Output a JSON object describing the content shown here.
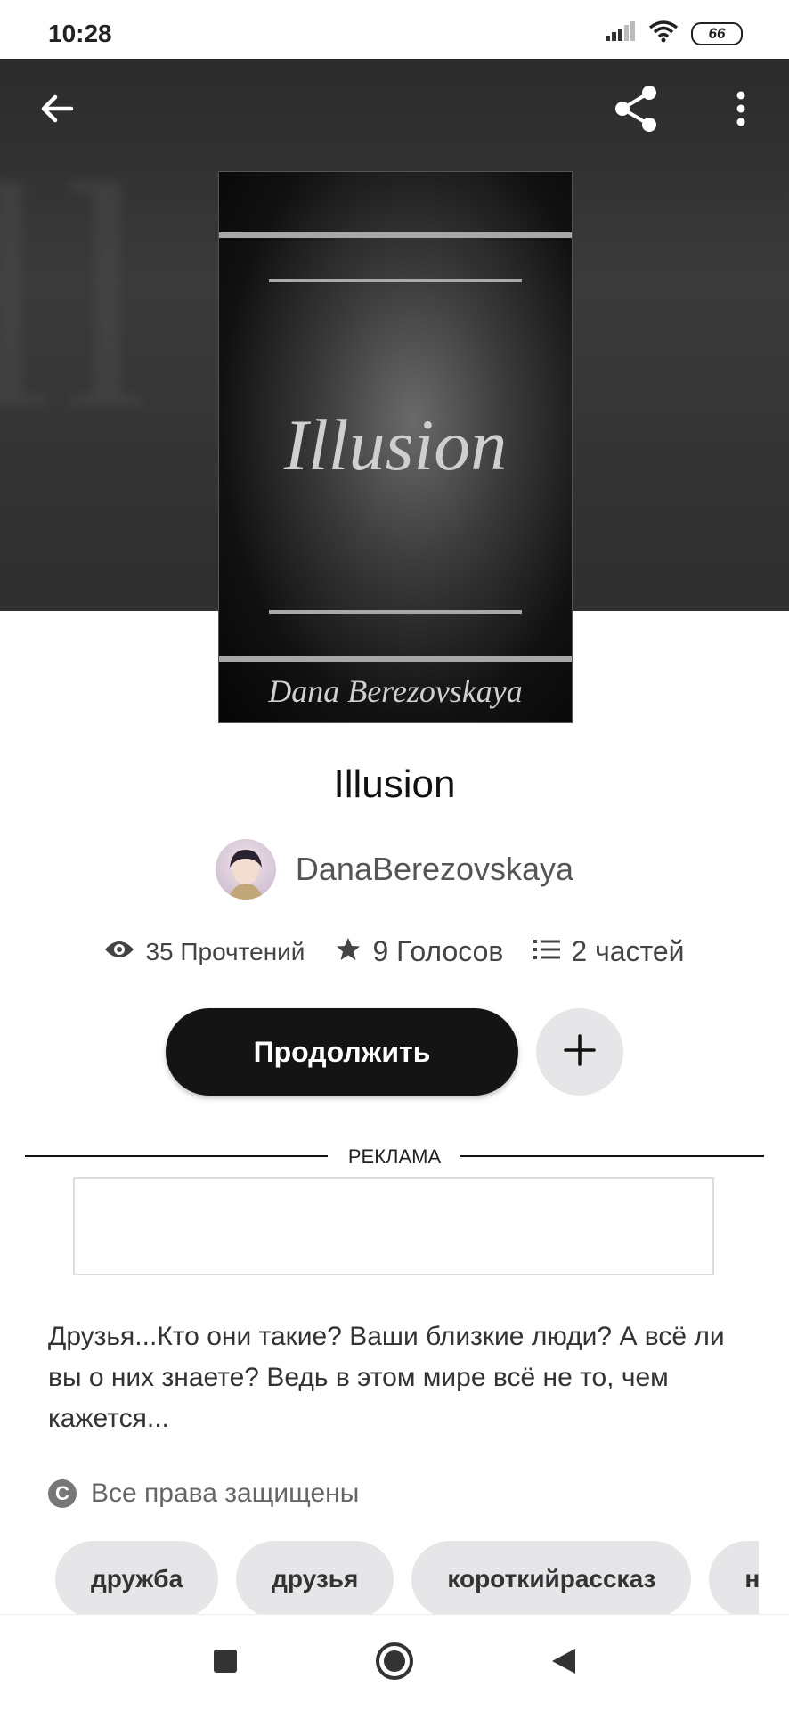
{
  "status_bar": {
    "time": "10:28",
    "battery": "66",
    "icons": [
      "signal-icon",
      "wifi-icon",
      "battery-icon"
    ]
  },
  "header": {
    "back_icon": "arrow-left-icon",
    "share_icon": "share-icon",
    "more_icon": "more-vertical-icon"
  },
  "cover": {
    "title": "Illusion",
    "author": "Dana Berezovskaya"
  },
  "story": {
    "title": "Illusion",
    "author": "DanaBerezovskaya"
  },
  "stats": {
    "reads": "35 Прочтений",
    "votes": "9 Голосов",
    "parts": "2 частей"
  },
  "actions": {
    "continue_label": "Продолжить",
    "add_icon": "plus-icon"
  },
  "ad": {
    "label": "РЕКЛАМА"
  },
  "description": "Друзья...Кто они такие? Ваши близкие люди? А всё ли вы о них знаете? Ведь в этом мире всё не то, чем кажется...",
  "rights": "Все права защищены",
  "tags": [
    "дружба",
    "друзья",
    "короткийрассказ",
    "не"
  ],
  "colors": {
    "header_bg": "#2f2f2f",
    "primary_button": "#141414",
    "tag_bg": "#e6e5e7"
  }
}
